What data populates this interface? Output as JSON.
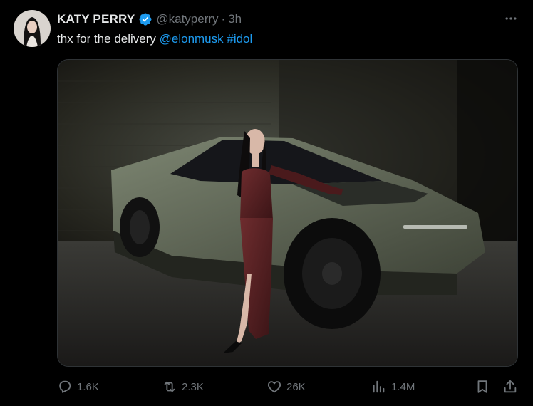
{
  "tweet": {
    "display_name": "KATY PERRY",
    "handle": "@katyperry",
    "separator": "·",
    "time": "3h",
    "text_plain": "thx for the delivery ",
    "mention": "@elonmusk",
    "text_space": " ",
    "hashtag": "#idol",
    "verified_color": "#1d9bf0"
  },
  "actions": {
    "replies": "1.6K",
    "reposts": "2.3K",
    "likes": "26K",
    "views": "1.4M"
  },
  "icons": {
    "more": "more-horizontal-icon",
    "reply": "reply-icon",
    "repost": "repost-icon",
    "like": "heart-icon",
    "views": "bar-chart-icon",
    "bookmark": "bookmark-icon",
    "share": "share-icon"
  },
  "colors": {
    "background": "#000000",
    "primary_text": "#e7e9ea",
    "secondary_text": "#71767b",
    "link": "#1d9bf0"
  }
}
